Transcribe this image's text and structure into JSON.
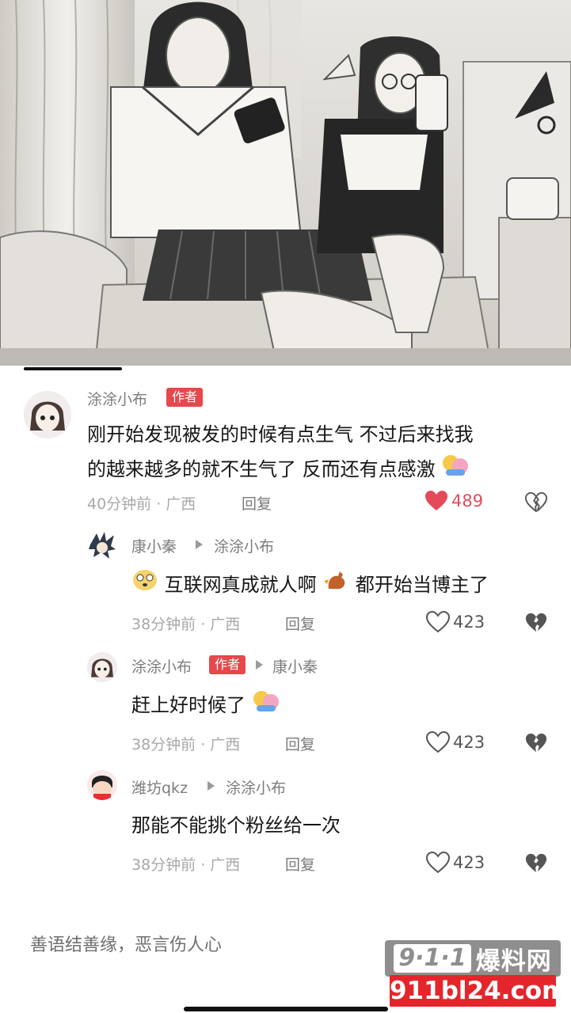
{
  "comments": [
    {
      "username": "涂涂小布",
      "tag": "作者",
      "text_line1": "刚开始发现被发的时候有点生气 不过后来找我",
      "text_line2": "的越来越多的就不生气了 反而还有点感激",
      "meta": "40分钟前 · 广西",
      "reply_label": "回复",
      "likes": "489"
    },
    {
      "username": "康小秦",
      "reply_to": "涂涂小布",
      "text_part1": "互联网真成就人啊",
      "text_part2": "都开始当博主了",
      "meta": "38分钟前 · 广西",
      "reply_label": "回复",
      "likes": "423"
    },
    {
      "username": "涂涂小布",
      "tag": "作者",
      "reply_to": "康小秦",
      "text": "赶上好时候了",
      "meta": "38分钟前 · 广西",
      "reply_label": "回复",
      "likes": "423"
    },
    {
      "username": "潍坊qkz",
      "reply_to": "涂涂小布",
      "text": "那能不能挑个粉丝给一次",
      "meta": "38分钟前 · 广西",
      "reply_label": "回复",
      "likes": "423"
    }
  ],
  "input_hint": "善语结善缘，恶言伤人心",
  "watermark": {
    "badge": "9·1·1",
    "title": "爆料网",
    "url": "911bl24.com"
  },
  "icons": {
    "like_active": "heart-filled-icon",
    "like": "heart-outline-icon",
    "dislike": "broken-heart-icon",
    "reply_arrow": "triangle-right-icon"
  },
  "colors": {
    "accent": "#e54a5a",
    "author_tag": "#e5484d",
    "watermark_red": "#e4262c"
  }
}
